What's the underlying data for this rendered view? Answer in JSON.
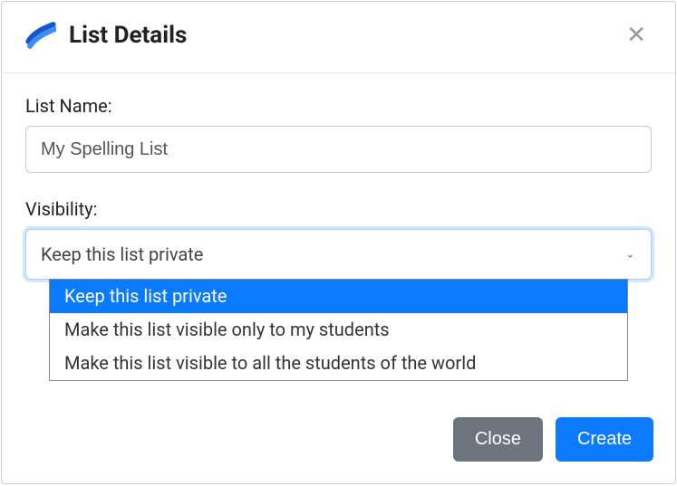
{
  "modal": {
    "title": "List Details",
    "list_name_label": "List Name:",
    "list_name_value": "My Spelling List",
    "visibility_label": "Visibility:",
    "visibility_selected": "Keep this list private",
    "visibility_options": [
      "Keep this list private",
      "Make this list visible only to my students",
      "Make this list visible to all the students of the world"
    ],
    "close_button": "Close",
    "create_button": "Create"
  }
}
